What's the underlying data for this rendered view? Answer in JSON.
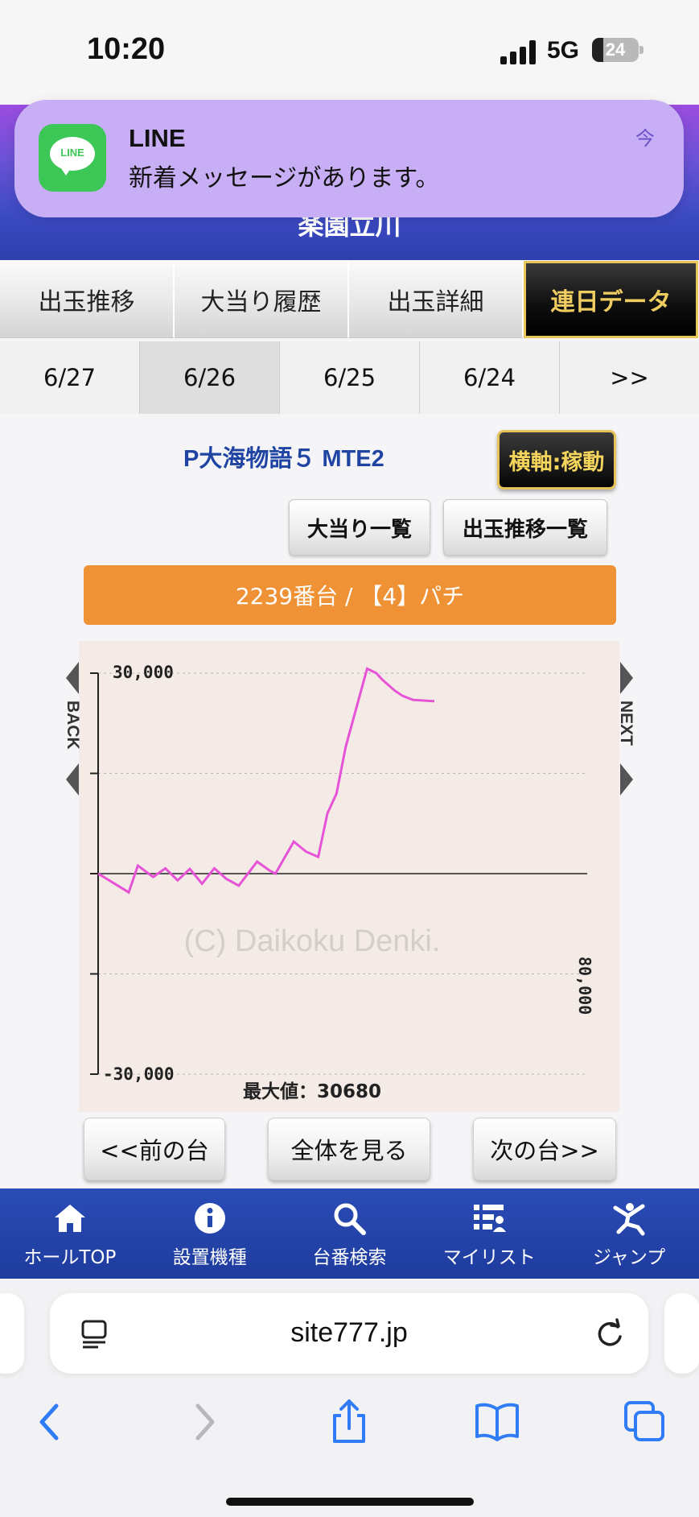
{
  "status_bar": {
    "time": "10:20",
    "network": "5G",
    "battery": "24",
    "battery_level": 0.24
  },
  "header": {
    "hall_name": "楽園立川"
  },
  "notification": {
    "app_icon_text": "LINE",
    "title": "LINE",
    "body": "新着メッセージがあります。",
    "time": "今"
  },
  "tabs": [
    {
      "label": "出玉推移",
      "active": false
    },
    {
      "label": "大当り履歴",
      "active": false
    },
    {
      "label": "出玉詳細",
      "active": false
    },
    {
      "label": "連日データ",
      "active": true
    }
  ],
  "dates": [
    {
      "label": "6/27",
      "selected": false
    },
    {
      "label": "6/26",
      "selected": true
    },
    {
      "label": "6/25",
      "selected": false
    },
    {
      "label": "6/24",
      "selected": false
    },
    {
      "label": ">>",
      "selected": false
    }
  ],
  "machine": {
    "name": "P大海物語５ MTE2",
    "axis_button": "横軸:稼動",
    "jackpot_list_button": "大当り一覧",
    "payout_list_button": "出玉推移一覧",
    "unit_label": "2239番台 / 【4】パチ"
  },
  "chart_side": {
    "back": "BACK",
    "next": "NEXT"
  },
  "chart_data": {
    "type": "line",
    "y_tick_labels": [
      "30,000",
      "-30,000"
    ],
    "ylim": [
      -30000,
      30000
    ],
    "x_end_label": "80,000",
    "xlim": [
      0,
      80000
    ],
    "watermark": "(C) Daikoku Denki.",
    "max_label": "最大値：30680",
    "line_color": "#e653d6",
    "series": [
      {
        "x": [
          0,
          5000,
          6500,
          9000,
          11000,
          13000,
          15000,
          17000,
          19000,
          21000,
          23000,
          26000,
          28000,
          29000,
          32000,
          34000,
          36000,
          37500,
          39000,
          40500,
          42000,
          44000,
          45500,
          46500,
          47500,
          48500,
          49800,
          51500,
          55000
        ],
        "y": [
          0,
          -2800,
          1200,
          -500,
          800,
          -1000,
          700,
          -1500,
          800,
          -800,
          -1800,
          1800,
          500,
          0,
          4800,
          3300,
          2500,
          9000,
          12000,
          19000,
          24000,
          30680,
          30000,
          29000,
          28200,
          27400,
          26600,
          26000,
          25800
        ]
      }
    ]
  },
  "nav_buttons": {
    "prev": "<<前の台",
    "all": "全体を見る",
    "next": "次の台>>"
  },
  "bottom_nav": [
    {
      "label": "ホールTOP",
      "icon": "home-icon"
    },
    {
      "label": "設置機種",
      "icon": "info-icon"
    },
    {
      "label": "台番検索",
      "icon": "search-icon"
    },
    {
      "label": "マイリスト",
      "icon": "list-icon"
    },
    {
      "label": "ジャンプ",
      "icon": "jump-icon"
    }
  ],
  "browser": {
    "url": "site777.jp"
  }
}
